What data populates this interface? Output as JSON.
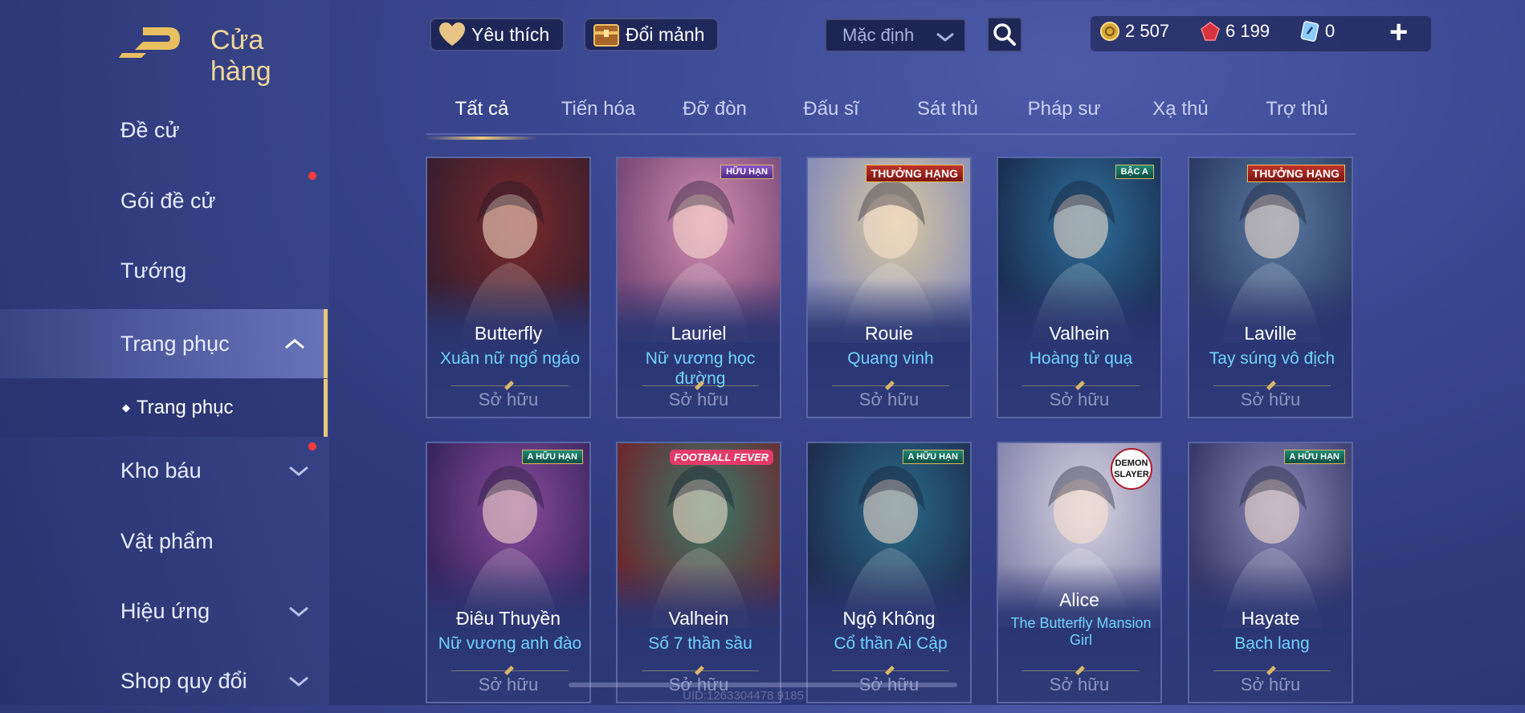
{
  "header": {
    "title": "Cửa hàng",
    "favorite_label": "Yêu thích",
    "exchange_label": "Đổi mảnh",
    "sort": {
      "selected": "Mặc định"
    },
    "currency": {
      "gold": "2 507",
      "gems": "6 199",
      "vouchers": "0"
    },
    "plus_label": "+"
  },
  "sidebar": {
    "items": [
      {
        "label": "Đề cử"
      },
      {
        "label": "Gói đề cử"
      },
      {
        "label": "Tướng"
      },
      {
        "label": "Trang phục"
      },
      {
        "label": "Kho báu"
      },
      {
        "label": "Vật phẩm"
      },
      {
        "label": "Hiệu ứng"
      },
      {
        "label": "Shop quy đổi"
      }
    ],
    "sub_item": "Trang phục"
  },
  "tabs": [
    "Tất cả",
    "Tiến hóa",
    "Đỡ đòn",
    "Đấu sĩ",
    "Sát thủ",
    "Pháp sư",
    "Xạ thủ",
    "Trợ thủ"
  ],
  "cards": [
    {
      "hero": "Butterfly",
      "skin": "Xuân nữ ngổ ngáo",
      "status": "Sở hữu",
      "palette": [
        "#7a2a2a",
        "#3a1e2e"
      ]
    },
    {
      "hero": "Lauriel",
      "skin": "Nữ vương học đường",
      "status": "Sở hữu",
      "badge": "HỮU HẠN",
      "palette": [
        "#d48fb0",
        "#7a4a78"
      ]
    },
    {
      "hero": "Rouie",
      "skin": "Quang vinh",
      "status": "Sở hữu",
      "badge": "THƯỞNG HẠNG",
      "palette": [
        "#d9c9a0",
        "#8a8fb8"
      ]
    },
    {
      "hero": "Valhein",
      "skin": "Hoàng tử quạ",
      "status": "Sở hữu",
      "badge": "BẬC A",
      "palette": [
        "#2f6f9a",
        "#1a2f52"
      ]
    },
    {
      "hero": "Laville",
      "skin": "Tay súng vô địch",
      "status": "Sở hữu",
      "badge": "THƯỞNG HẠNG",
      "palette": [
        "#5a7aa0",
        "#2c3c66"
      ]
    },
    {
      "hero": "Điêu Thuyền",
      "skin": "Nữ vương anh đào",
      "status": "Sở hữu",
      "badge": "A HỮU HẠN",
      "palette": [
        "#8a4a9a",
        "#3a2660"
      ]
    },
    {
      "hero": "Valhein",
      "skin": "Số 7 thần sầu",
      "status": "Sở hữu",
      "badge": "FOOTBALL FEVER",
      "palette": [
        "#3a7a6a",
        "#6a2a30"
      ]
    },
    {
      "hero": "Ngộ Không",
      "skin": "Cổ thần Ai Cập",
      "status": "Sở hữu",
      "badge": "A HỮU HẠN",
      "palette": [
        "#2a6a8a",
        "#1e2e4e"
      ]
    },
    {
      "hero": "Alice",
      "skin": "The Butterfly Mansion Girl",
      "status": "Sở hữu",
      "badge": "DEMON SLAYER",
      "palette": [
        "#d8d4e0",
        "#8a8ab0"
      ]
    },
    {
      "hero": "Hayate",
      "skin": "Bạch lang",
      "status": "Sở hữu",
      "badge": "A HỮU HẠN",
      "palette": [
        "#8a8ab8",
        "#3a3a6a"
      ]
    }
  ],
  "footer": {
    "watermark": "UID:1263304478 9185"
  }
}
